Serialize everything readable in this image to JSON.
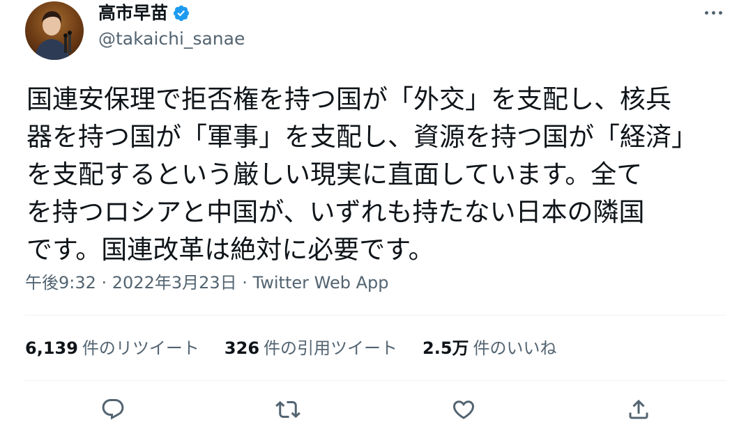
{
  "author": {
    "display_name": "高市早苗",
    "handle": "@takaichi_sanae",
    "avatar_icon": "profile-photo",
    "verified_icon": "verified-badge-icon",
    "verified_color": "#1d9bf0"
  },
  "tweet": {
    "lines": [
      "国連安保理で拒否権を持つ国が「外交」を支配し、核兵",
      "器を持つ国が「軍事」を支配し、資源を持つ国が「経済」",
      "を支配するという厳しい現実に直面しています。全て",
      "を持つロシアと中国が、いずれも持たない日本の隣国",
      "です。国連改革は絶対に必要です。"
    ]
  },
  "meta": {
    "text": "午後9:32 · 2022年3月23日 · Twitter Web App"
  },
  "stats": {
    "retweets_count": "6,139",
    "retweets_label": "件のリツイート",
    "quotes_count": "326",
    "quotes_label": "件の引用ツイート",
    "likes_count": "2.5万",
    "likes_label": "件のいいね"
  },
  "actions": [
    "reply-icon",
    "retweet-icon",
    "like-icon",
    "share-icon"
  ],
  "colors": {
    "text": "#0f1419",
    "secondary": "#536471",
    "divider": "#eff3f4"
  }
}
